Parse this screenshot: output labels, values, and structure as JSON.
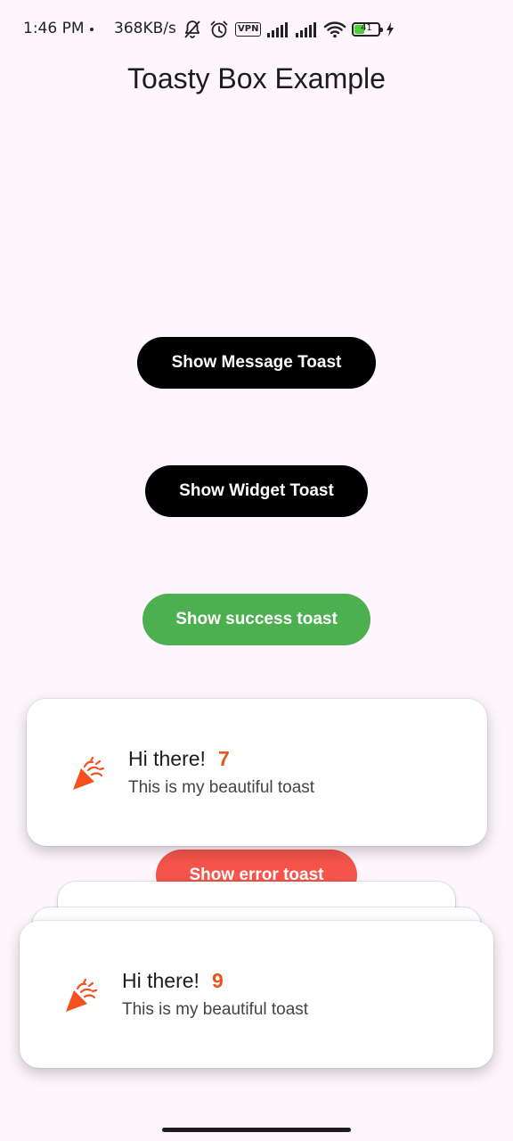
{
  "status_bar": {
    "time": "1:46 PM",
    "speed": "368KB/s",
    "vpn": "VPN",
    "battery_level": "41",
    "battery_fraction": 0.41,
    "icons": [
      "bell-off-icon",
      "alarm-icon",
      "vpn-icon",
      "signal-icon",
      "signal-icon",
      "wifi-icon",
      "battery-icon",
      "charging-icon"
    ]
  },
  "app_bar": {
    "title": "Toasty Box Example"
  },
  "buttons": {
    "message": "Show Message Toast",
    "widget": "Show Widget Toast",
    "success": "Show success toast",
    "error": "Show error toast"
  },
  "toasts": [
    {
      "icon": "party-popper-icon",
      "title": "Hi there!",
      "count": "7",
      "body": "This is my beautiful toast"
    },
    {
      "icon": "party-popper-icon",
      "title": "Hi there!",
      "count": "9",
      "body": "This is my beautiful toast"
    }
  ],
  "colors": {
    "background": "#fdf7fd",
    "primary_button": "#000000",
    "success": "#4caf50",
    "error": "#f44336",
    "accent": "#e8551c"
  }
}
